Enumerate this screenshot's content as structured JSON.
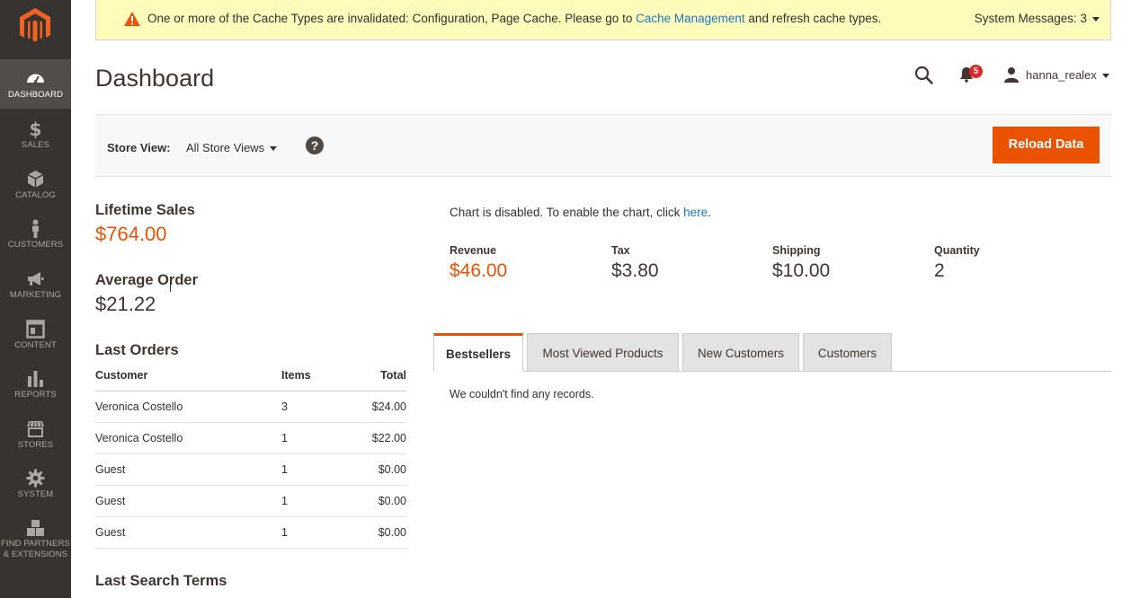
{
  "sidebar": {
    "items": [
      {
        "label": "DASHBOARD",
        "icon": "dashboard-icon"
      },
      {
        "label": "SALES",
        "icon": "dollar-icon"
      },
      {
        "label": "CATALOG",
        "icon": "box-icon"
      },
      {
        "label": "CUSTOMERS",
        "icon": "person-icon"
      },
      {
        "label": "MARKETING",
        "icon": "megaphone-icon"
      },
      {
        "label": "CONTENT",
        "icon": "content-icon"
      },
      {
        "label": "REPORTS",
        "icon": "bar-chart-icon"
      },
      {
        "label": "STORES",
        "icon": "store-icon"
      },
      {
        "label": "SYSTEM",
        "icon": "gear-icon"
      },
      {
        "label_line1": "FIND PARTNERS",
        "label_line2": "& EXTENSIONS",
        "icon": "boxes-icon"
      }
    ]
  },
  "message": {
    "text_before": "One or more of the Cache Types are invalidated: Configuration, Page Cache. Please go to ",
    "link": "Cache Management",
    "text_after": " and refresh cache types.",
    "system_messages": "System Messages: 3"
  },
  "header": {
    "title": "Dashboard",
    "notification_count": "5",
    "username": "hanna_realex"
  },
  "store": {
    "label": "Store View:",
    "selected": "All Store Views",
    "help": "?",
    "reload_button": "Reload Data"
  },
  "stats": {
    "lifetime_sales_label": "Lifetime Sales",
    "lifetime_sales_value": "$764.00",
    "average_order_label": "Average Order",
    "average_order_value": "$21.22"
  },
  "last_orders": {
    "title": "Last Orders",
    "columns": [
      "Customer",
      "Items",
      "Total"
    ],
    "rows": [
      [
        "Veronica Costello",
        "3",
        "$24.00"
      ],
      [
        "Veronica Costello",
        "1",
        "$22.00"
      ],
      [
        "Guest",
        "1",
        "$0.00"
      ],
      [
        "Guest",
        "1",
        "$0.00"
      ],
      [
        "Guest",
        "1",
        "$0.00"
      ]
    ]
  },
  "last_search_terms_title": "Last Search Terms",
  "chart": {
    "note": "Chart is disabled. To enable the chart, click ",
    "link": "here",
    "period": "."
  },
  "totals": [
    {
      "label": "Revenue",
      "value": "$46.00"
    },
    {
      "label": "Tax",
      "value": "$3.80"
    },
    {
      "label": "Shipping",
      "value": "$10.00"
    },
    {
      "label": "Quantity",
      "value": "2"
    }
  ],
  "tabs": [
    "Bestsellers",
    "Most Viewed Products",
    "New Customers",
    "Customers"
  ],
  "tab_content": "We couldn't find any records.",
  "colors": {
    "accent": "#eb5202",
    "sidebar": "#373330",
    "link": "#1979c3",
    "message_bg": "#fffbbb"
  }
}
